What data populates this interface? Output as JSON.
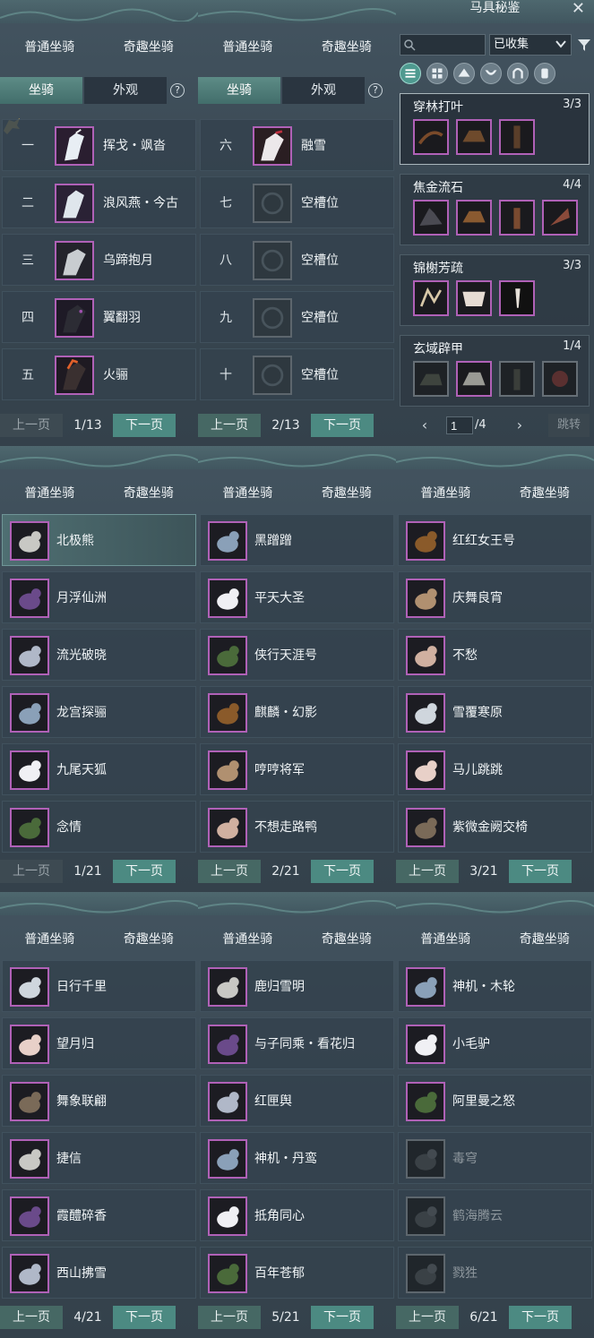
{
  "tabs": {
    "normal": "普通坐骑",
    "odd": "奇趣坐骑"
  },
  "subtabs": {
    "mount": "坐骑",
    "look": "外观",
    "help": "?"
  },
  "pager": {
    "prev": "上一页",
    "next": "下一页"
  },
  "panel1": {
    "page": "1/13",
    "rows": [
      {
        "num": "一",
        "name": "挥戈・飒沓"
      },
      {
        "num": "二",
        "name": "浪风燕・今古"
      },
      {
        "num": "三",
        "name": "乌蹄抱月"
      },
      {
        "num": "四",
        "name": "翼翻羽"
      },
      {
        "num": "五",
        "name": "火骊"
      }
    ]
  },
  "panel2": {
    "page": "2/13",
    "rows": [
      {
        "num": "六",
        "name": "融雪"
      },
      {
        "num": "七",
        "name": "空槽位"
      },
      {
        "num": "八",
        "name": "空槽位"
      },
      {
        "num": "九",
        "name": "空槽位"
      },
      {
        "num": "十",
        "name": "空槽位"
      }
    ]
  },
  "collection": {
    "title": "马具秘鉴",
    "search_placeholder": "",
    "filter_value": "已收集",
    "sets": [
      {
        "title": "穿林打叶",
        "count": "3/3"
      },
      {
        "title": "焦金流石",
        "count": "4/4"
      },
      {
        "title": "锦榭芳疏",
        "count": "3/3"
      },
      {
        "title": "玄域辟甲",
        "count": "1/4"
      }
    ],
    "page_value": "1",
    "page_total": "/4",
    "jump": "跳转",
    "prev_arrow": "‹",
    "next_arrow": "›"
  },
  "panel4": {
    "page": "1/21",
    "rows": [
      "北极熊",
      "月浮仙洲",
      "流光破晓",
      "龙宫探骊",
      "九尾天狐",
      "念情"
    ]
  },
  "panel5": {
    "page": "2/21",
    "rows": [
      "黑蹭蹭",
      "平天大圣",
      "侠行天涯号",
      "麒麟・幻影",
      "哼哼将军",
      "不想走路鸭"
    ]
  },
  "panel6": {
    "page": "3/21",
    "rows": [
      "红红女王号",
      "庆舞良宵",
      "不愁",
      "雪覆寒原",
      "马儿跳跳",
      "紫微金阙交椅"
    ]
  },
  "panel7": {
    "page": "4/21",
    "rows": [
      "日行千里",
      "望月归",
      "舞象联翩",
      "捷信",
      "霞醴碎香",
      "西山拂雪"
    ]
  },
  "panel8": {
    "page": "5/21",
    "rows": [
      "鹿归雪明",
      "与子同乘・看花归",
      "红匣舆",
      "神机・丹鸾",
      "抵角同心",
      "百年苍郁"
    ]
  },
  "panel9": {
    "page": "6/21",
    "rows": [
      "神机・木轮",
      "小毛驴",
      "阿里曼之怒",
      "毒穹",
      "鹤海腾云",
      "戮狌"
    ]
  },
  "colors": {
    "accent": "#4c8a82",
    "rarity_purple": "#b061b7",
    "panel_bg": "#3a4853"
  }
}
